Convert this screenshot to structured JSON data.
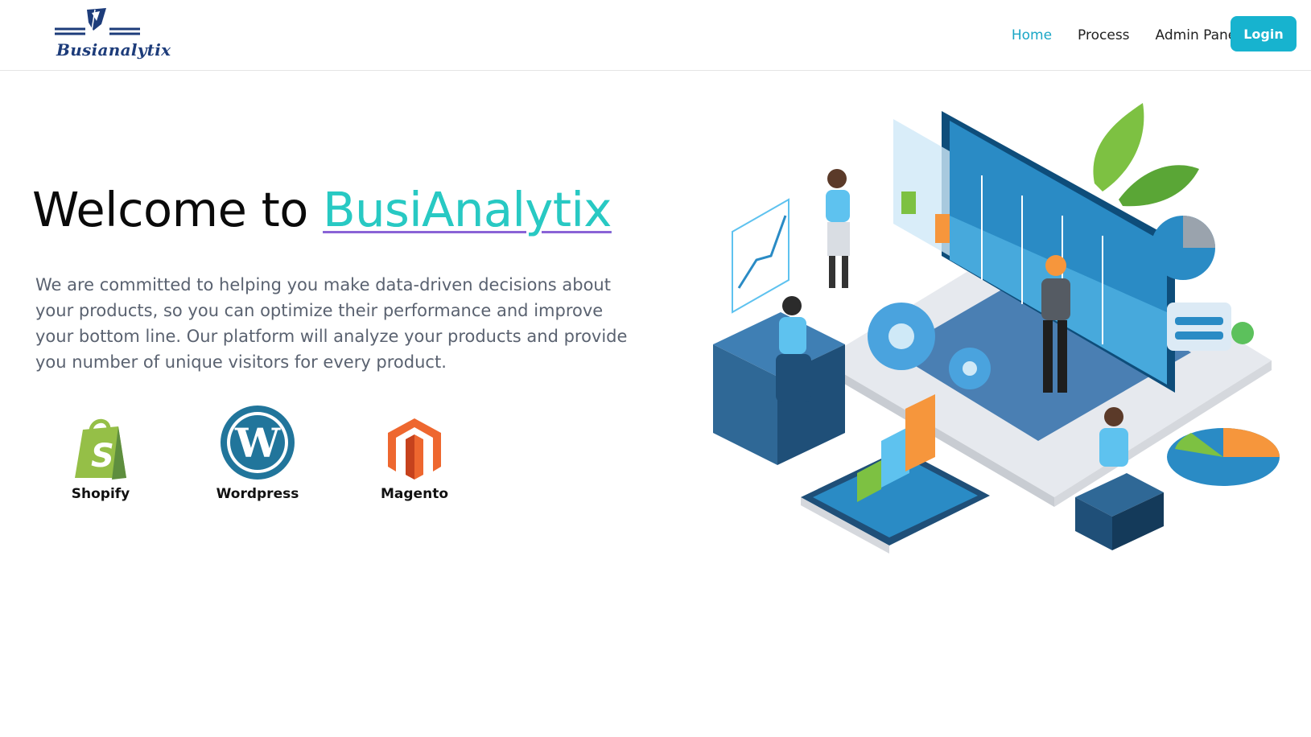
{
  "header": {
    "logo_text": "Busianalytix",
    "nav": [
      {
        "label": "Home",
        "active": true
      },
      {
        "label": "Process",
        "active": false
      },
      {
        "label": "Admin Panel",
        "active": false
      }
    ],
    "login_label": "Login"
  },
  "hero": {
    "title_prefix": "Welcome to ",
    "title_brand": "BusiAnalytix",
    "description": "We are committed to helping you make data-driven decisions about your products, so you can optimize their performance and improve your bottom line. Our platform will analyze your products and provide you number of unique visitors for every product."
  },
  "platforms": [
    {
      "label": "Shopify",
      "icon": "shopify-icon"
    },
    {
      "label": "Wordpress",
      "icon": "wordpress-icon"
    },
    {
      "label": "Magento",
      "icon": "magento-icon"
    }
  ],
  "colors": {
    "accent": "#17b3cf",
    "brand_teal": "#28c9c3",
    "underline_purple": "#8a63d6",
    "text_muted": "#5a6270"
  }
}
